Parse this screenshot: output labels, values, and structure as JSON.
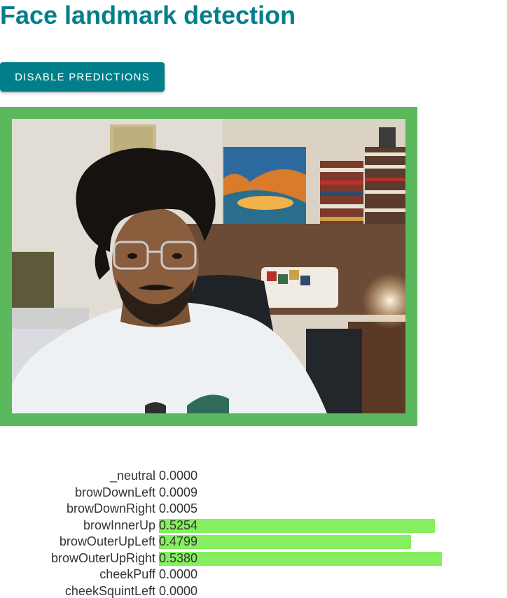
{
  "title": "Face landmark detection",
  "toggle_button_label": "DISABLE PREDICTIONS",
  "colors": {
    "accent": "#007f8b",
    "frame": "#5cb85c",
    "bar": "#86ee60"
  },
  "blendshapes": [
    {
      "name": "_neutral",
      "score": "0.0000",
      "value": 0.0
    },
    {
      "name": "browDownLeft",
      "score": "0.0009",
      "value": 0.0009
    },
    {
      "name": "browDownRight",
      "score": "0.0005",
      "value": 0.0005
    },
    {
      "name": "browInnerUp",
      "score": "0.5254",
      "value": 0.5254
    },
    {
      "name": "browOuterUpLeft",
      "score": "0.4799",
      "value": 0.4799
    },
    {
      "name": "browOuterUpRight",
      "score": "0.5380",
      "value": 0.538
    },
    {
      "name": "cheekPuff",
      "score": "0.0000",
      "value": 0.0
    },
    {
      "name": "cheekSquintLeft",
      "score": "0.0000",
      "value": 0.0
    }
  ]
}
